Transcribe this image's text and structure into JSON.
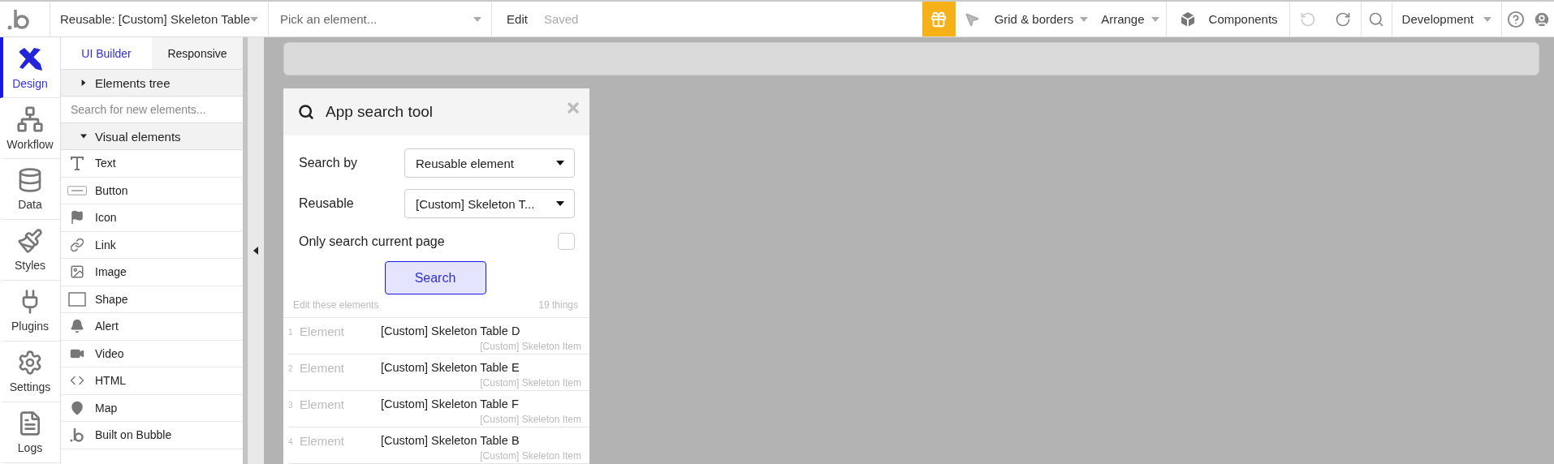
{
  "topbar": {
    "reusable": "Reusable: [Custom] Skeleton Table",
    "element_picker": {
      "placeholder": "Pick an element..."
    },
    "edit": "Edit",
    "saved": "Saved",
    "grid": "Grid & borders",
    "arrange": "Arrange",
    "components": "Components",
    "environment": "Development"
  },
  "nav": [
    {
      "label": "Design",
      "selected": true
    },
    {
      "label": "Workflow",
      "selected": false
    },
    {
      "label": "Data",
      "selected": false
    },
    {
      "label": "Styles",
      "selected": false
    },
    {
      "label": "Plugins",
      "selected": false
    },
    {
      "label": "Settings",
      "selected": false
    },
    {
      "label": "Logs",
      "selected": false
    }
  ],
  "panel_tabs": [
    {
      "label": "UI Builder",
      "selected": true
    },
    {
      "label": "Responsive",
      "selected": false
    }
  ],
  "elements_tree": {
    "label": "Elements tree",
    "expanded": false
  },
  "element_search": {
    "placeholder": "Search for new elements..."
  },
  "visual_elements": {
    "label": "Visual elements",
    "expanded": true,
    "items": [
      "Text",
      "Button",
      "Icon",
      "Link",
      "Image",
      "Shape",
      "Alert",
      "Video",
      "HTML",
      "Map",
      "Built on Bubble"
    ]
  },
  "search_tool": {
    "title": "App search tool",
    "search_by_label": "Search by",
    "search_by_value": "Reusable element",
    "reusable_label": "Reusable",
    "reusable_value": "[Custom] Skeleton T...",
    "only_page_label": "Only search current page",
    "only_page_checked": false,
    "search_button": "Search",
    "results_label": "Edit these elements",
    "results_count": "19 things",
    "results": [
      {
        "index": "1",
        "type": "Element",
        "name": "[Custom] Skeleton Table D",
        "parent": "[Custom] Skeleton Item"
      },
      {
        "index": "2",
        "type": "Element",
        "name": "[Custom] Skeleton Table E",
        "parent": "[Custom] Skeleton Item"
      },
      {
        "index": "3",
        "type": "Element",
        "name": "[Custom] Skeleton Table F",
        "parent": "[Custom] Skeleton Item"
      },
      {
        "index": "4",
        "type": "Element",
        "name": "[Custom] Skeleton Table B",
        "parent": "[Custom] Skeleton Item"
      }
    ]
  }
}
